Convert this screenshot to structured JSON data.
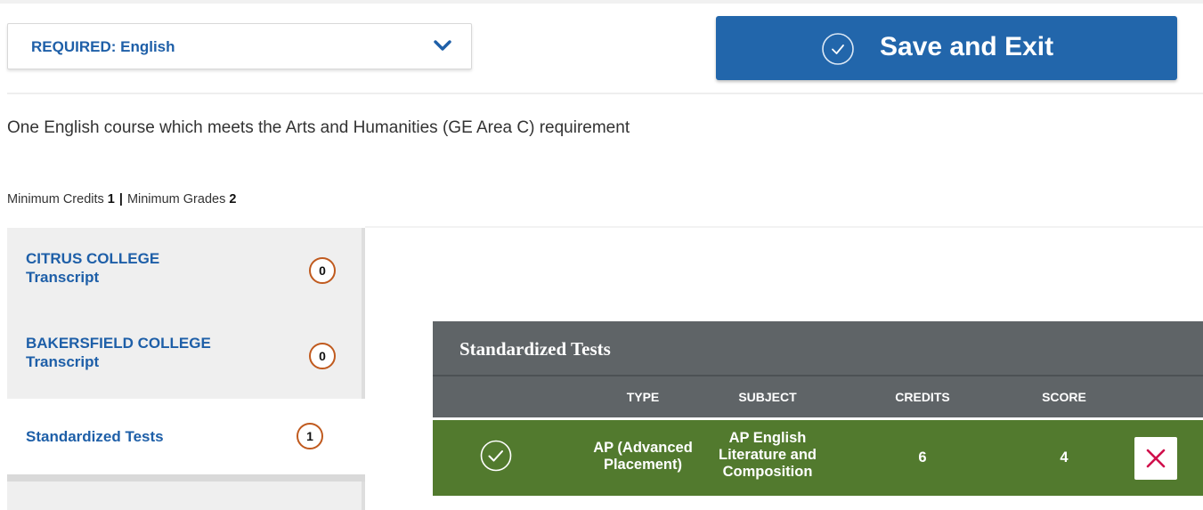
{
  "requirement_select": {
    "selected": "REQUIRED: English",
    "chevron_icon": "chevron-down-icon"
  },
  "save_button": {
    "label": "Save and Exit",
    "icon": "check-circle-icon"
  },
  "requirement": {
    "description": "One English course which meets the Arts and Humanities (GE Area C) requirement",
    "min_credits_label": "Minimum Credits",
    "min_credits_value": "1",
    "separator": "|",
    "min_grades_label": "Minimum Grades",
    "min_grades_value": "2"
  },
  "sources": [
    {
      "name": "CITRUS COLLEGE",
      "sub": "Transcript",
      "count": "0"
    },
    {
      "name": "BAKERSFIELD COLLEGE",
      "sub": "Transcript",
      "count": "0"
    },
    {
      "name": "Standardized Tests",
      "count": "1"
    }
  ],
  "tests_panel": {
    "title": "Standardized Tests",
    "columns": [
      "TYPE",
      "SUBJECT",
      "CREDITS",
      "SCORE"
    ],
    "rows": [
      {
        "type_line1": "AP (Advanced",
        "type_line2": "Placement)",
        "subject_line1": "AP English",
        "subject_line2": "Literature and",
        "subject_line3": "Composition",
        "credits": "6",
        "score": "4",
        "status_icon": "check-circle-icon",
        "remove_icon": "close-icon"
      }
    ]
  },
  "colors": {
    "link_blue": "#1e5fa8",
    "button_blue": "#2266ab",
    "header_gray": "#5f6467",
    "row_green": "#527a2e",
    "badge_orange": "#c05a1e",
    "remove_red": "#d0104c"
  }
}
